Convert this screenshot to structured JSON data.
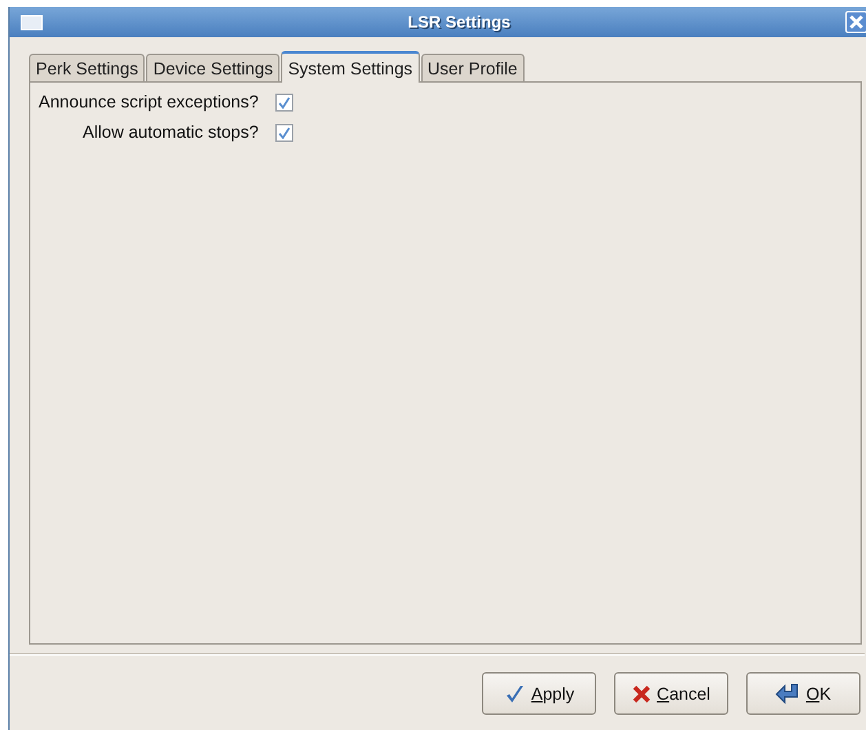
{
  "window": {
    "title": "LSR Settings"
  },
  "tabs": [
    {
      "label": "Perk Settings",
      "selected": false
    },
    {
      "label": "Device Settings",
      "selected": false
    },
    {
      "label": "System Settings",
      "selected": true
    },
    {
      "label": "User Profile",
      "selected": false
    }
  ],
  "options": [
    {
      "label": "Announce script exceptions?",
      "checked": true
    },
    {
      "label": "Allow automatic stops?",
      "checked": true
    }
  ],
  "buttons": [
    {
      "kind": "apply",
      "mnemonic": "A",
      "rest": "pply"
    },
    {
      "kind": "cancel",
      "mnemonic": "C",
      "rest": "ancel"
    },
    {
      "kind": "ok",
      "mnemonic": "O",
      "rest": "K"
    }
  ]
}
